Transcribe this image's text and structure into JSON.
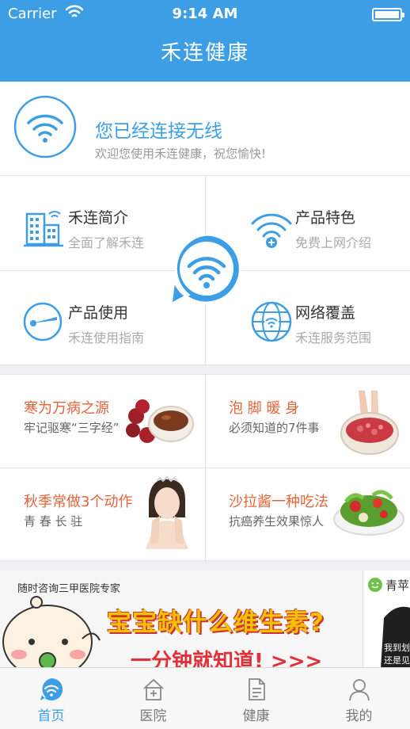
{
  "status_bar": {
    "carrier": "Carrier",
    "time": "9:14 AM"
  },
  "nav": {
    "title": "禾连健康"
  },
  "connection": {
    "title": "您已经连接无线",
    "subtitle": "欢迎您使用禾连健康，祝您愉快!"
  },
  "features": [
    {
      "title": "禾连简介",
      "subtitle": "全面了解禾连",
      "icon": "building-icon"
    },
    {
      "title": "产品特色",
      "subtitle": "免费上网介绍",
      "icon": "wifi-plus-icon"
    },
    {
      "title": "产品使用",
      "subtitle": "禾连使用指南",
      "icon": "usage-icon"
    },
    {
      "title": "网络覆盖",
      "subtitle": "禾连服务范围",
      "icon": "globe-wifi-icon"
    }
  ],
  "articles": [
    {
      "title": "寒为万病之源",
      "subtitle": "牢记驱寒“三字经”"
    },
    {
      "title": "泡 脚 暖 身",
      "subtitle": "必须知道的7件事"
    },
    {
      "title": "秋季常做3个动作",
      "subtitle": "青 春 长 驻"
    },
    {
      "title": "沙拉酱一种吃法",
      "subtitle": "抗癌养生效果惊人"
    }
  ],
  "ad": {
    "caption": "随时咨询三甲医院专家",
    "headline": "宝宝缺什么维生素?",
    "sub": "一分钟就知道! >>>",
    "right_label": "青苹",
    "right_text": "我到划 还是见了"
  },
  "tabs": [
    {
      "label": "首页",
      "icon": "home-wifi-icon",
      "active": true
    },
    {
      "label": "医院",
      "icon": "hospital-icon",
      "active": false
    },
    {
      "label": "健康",
      "icon": "document-icon",
      "active": false
    },
    {
      "label": "我的",
      "icon": "profile-icon",
      "active": false
    }
  ],
  "colors": {
    "accent": "#3d9ee6",
    "article_title": "#e4643a"
  }
}
